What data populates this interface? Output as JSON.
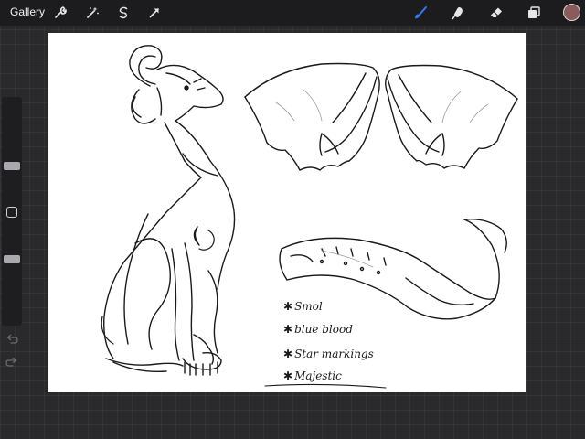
{
  "toolbar": {
    "gallery_label": "Gallery",
    "left_tools": [
      "wrench-icon",
      "magic-wand-icon",
      "selection-icon",
      "transform-arrow-icon"
    ],
    "right_tools": [
      "brush-icon",
      "smudge-icon",
      "eraser-icon",
      "layers-icon"
    ],
    "active_tool": "brush-icon",
    "accent_color": "#2e7cf6",
    "current_color": "#8b5a5a"
  },
  "sidebar": {
    "brush_size_level": 0.3,
    "opacity_level": 0.75
  },
  "canvas": {
    "background": "#ffffff",
    "notes": [
      {
        "star": "✱",
        "text": "Smol"
      },
      {
        "star": "✱",
        "text": "blue blood"
      },
      {
        "star": "✱",
        "text": "Star markings"
      },
      {
        "star": "✱",
        "text": "Majestic"
      }
    ]
  }
}
